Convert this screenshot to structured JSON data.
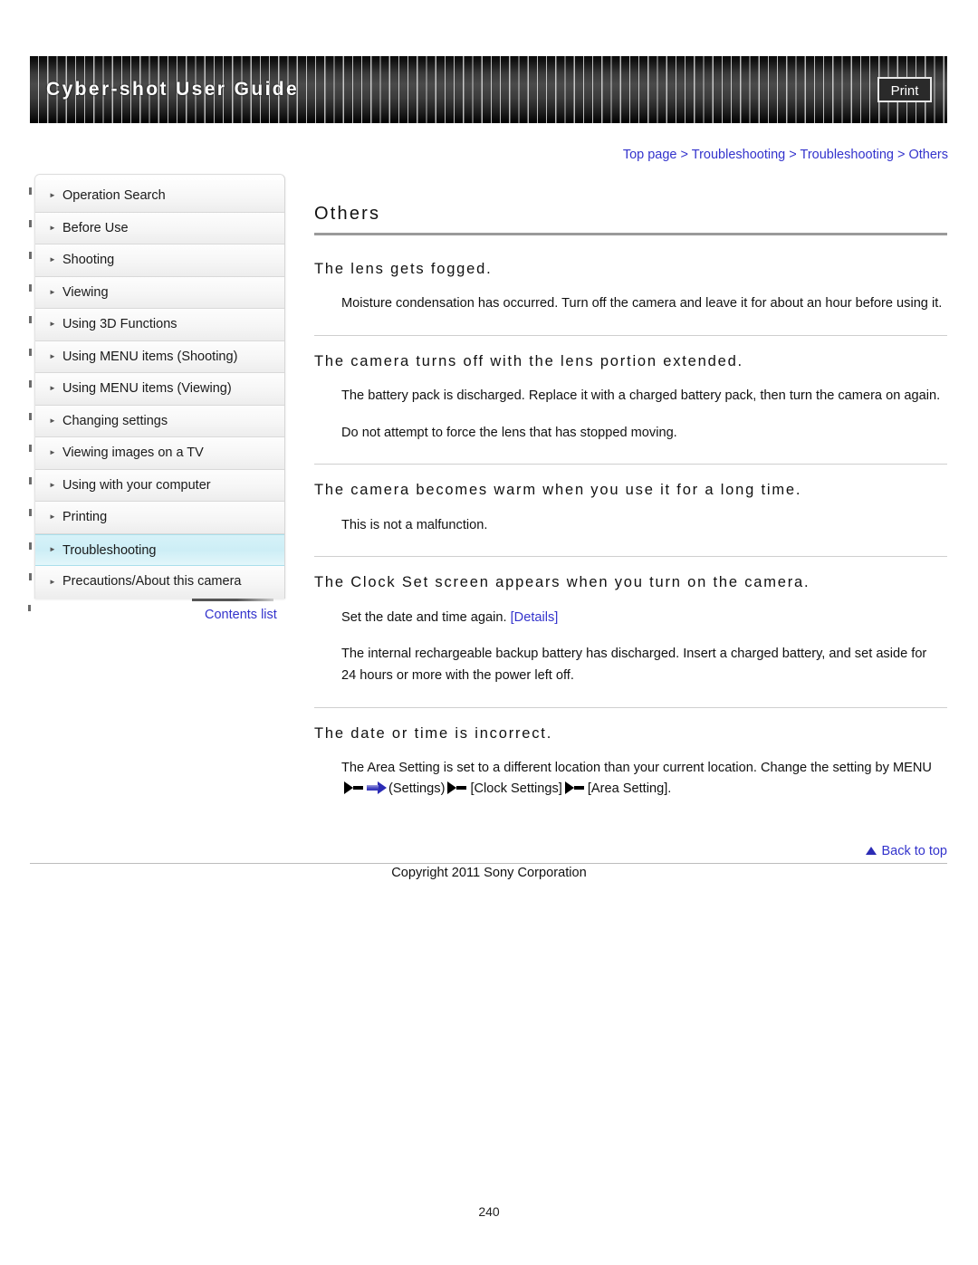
{
  "header": {
    "title": "Cyber-shot User Guide",
    "print_label": "Print"
  },
  "breadcrumb": {
    "items": [
      "Top page",
      "Troubleshooting",
      "Troubleshooting",
      "Others"
    ],
    "separator": ">",
    "full_text": "Top page > Troubleshooting > Troubleshooting > Others"
  },
  "sidebar": {
    "items": [
      {
        "label": "Operation Search",
        "active": false
      },
      {
        "label": "Before Use",
        "active": false
      },
      {
        "label": "Shooting",
        "active": false
      },
      {
        "label": "Viewing",
        "active": false
      },
      {
        "label": "Using 3D Functions",
        "active": false
      },
      {
        "label": "Using MENU items (Shooting)",
        "active": false
      },
      {
        "label": "Using MENU items (Viewing)",
        "active": false
      },
      {
        "label": "Changing settings",
        "active": false
      },
      {
        "label": "Viewing images on a TV",
        "active": false
      },
      {
        "label": "Using with your computer",
        "active": false
      },
      {
        "label": "Printing",
        "active": false
      },
      {
        "label": "Troubleshooting",
        "active": true
      },
      {
        "label": "Precautions/About this camera",
        "active": false
      }
    ],
    "contents_list_label": "Contents list"
  },
  "main": {
    "page_title": "Others",
    "sections": [
      {
        "heading": "The lens gets fogged.",
        "paragraphs": [
          "Moisture condensation has occurred. Turn off the camera and leave it for about an hour before using it."
        ]
      },
      {
        "heading": "The camera turns off with the lens portion extended.",
        "paragraphs": [
          "The battery pack is discharged. Replace it with a charged battery pack, then turn the camera on again.",
          "Do not attempt to force the lens that has stopped moving."
        ]
      },
      {
        "heading": "The camera becomes warm when you use it for a long time.",
        "paragraphs": [
          "This is not a malfunction."
        ]
      },
      {
        "heading": "The Clock Set screen appears when you turn on the camera.",
        "paragraphs": [
          "Set the date and time again.",
          "The internal rechargeable backup battery has discharged. Insert a charged battery, and set aside for 24 hours or more with the power left off."
        ],
        "details_link": "[Details]"
      },
      {
        "heading": "The date or time is incorrect.",
        "menu_path": {
          "lead": "The Area Setting is set to a different location than your current location. Change the setting by MENU",
          "step1": "(Settings)",
          "step2": "[Clock Settings]",
          "step3": "[Area Setting]."
        }
      }
    ]
  },
  "footer": {
    "back_to_top_label": "Back to top",
    "copyright": "Copyright 2011 Sony Corporation",
    "page_number": "240"
  }
}
